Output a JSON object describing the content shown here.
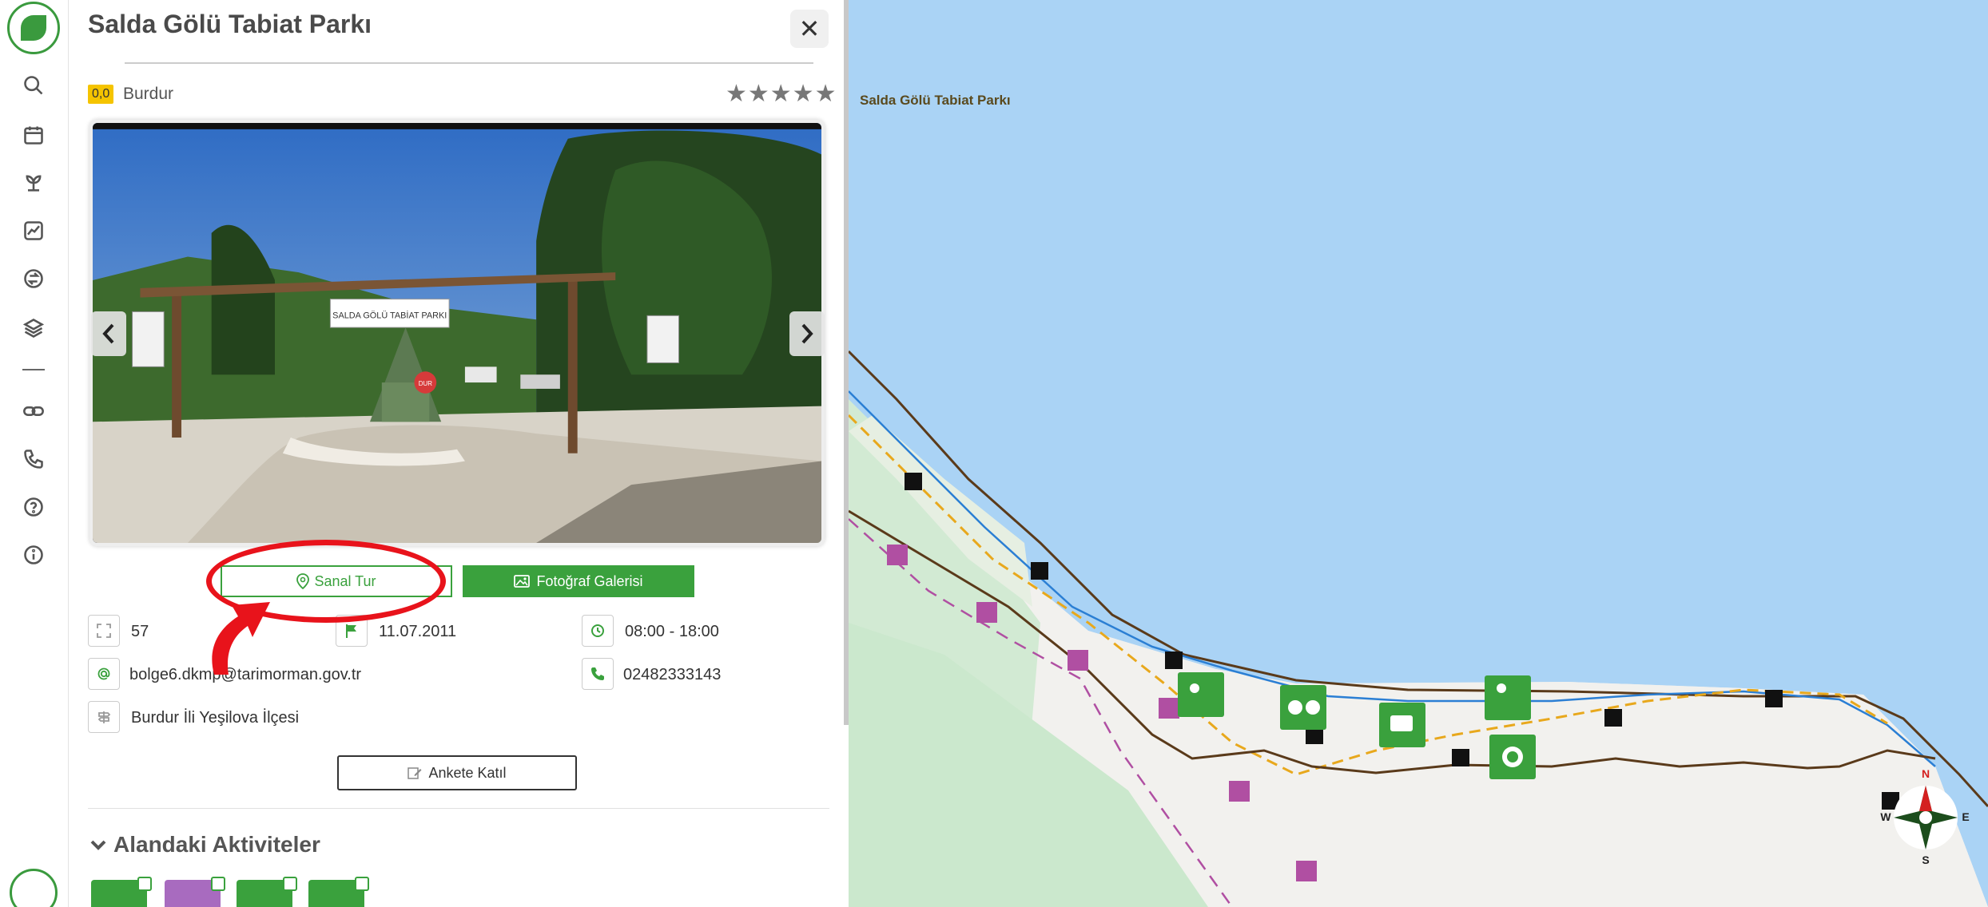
{
  "sidebar": {
    "items": [
      {
        "name": "search",
        "icon": "search-icon"
      },
      {
        "name": "calendar",
        "icon": "calendar-icon"
      },
      {
        "name": "plant",
        "icon": "plant-icon"
      },
      {
        "name": "stats",
        "icon": "trend-chart-icon"
      },
      {
        "name": "transfer",
        "icon": "swap-icon"
      },
      {
        "name": "layers",
        "icon": "layers-icon"
      },
      {
        "name": "link",
        "icon": "link-icon"
      },
      {
        "name": "phone",
        "icon": "phone-icon"
      },
      {
        "name": "help",
        "icon": "help-icon"
      },
      {
        "name": "info",
        "icon": "info-icon"
      }
    ]
  },
  "panel": {
    "title": "Salda Gölü Tabiat Parkı",
    "close_label": "✕",
    "rating_value": "0,0",
    "province": "Burdur",
    "stars": "★★★★★",
    "virtual_tour_label": "Sanal Tur",
    "gallery_label": "Fotoğraf Galerisi",
    "info": {
      "area": "57",
      "date": "11.07.2011",
      "hours": "08:00 - 18:00",
      "email": "bolge6.dkmp@tarimorman.gov.tr",
      "phone": "02482333143",
      "address": "Burdur İli Yeşilova İlçesi"
    },
    "survey_label": "Ankete Katıl",
    "activities_title": "Alandaki Aktiviteler"
  },
  "photo": {
    "sign_text": "SALDA GÖLÜ TABİAT PARKI",
    "stop_text": "DUR"
  },
  "map": {
    "label": "Salda Gölü Tabiat Parkı",
    "compass": {
      "n": "N",
      "s": "S",
      "e": "E",
      "w": "W"
    }
  },
  "colors": {
    "accent": "#3aa13d",
    "lake": "#aad3f5",
    "highlight": "#e8131b",
    "badge": "#f5c400"
  }
}
